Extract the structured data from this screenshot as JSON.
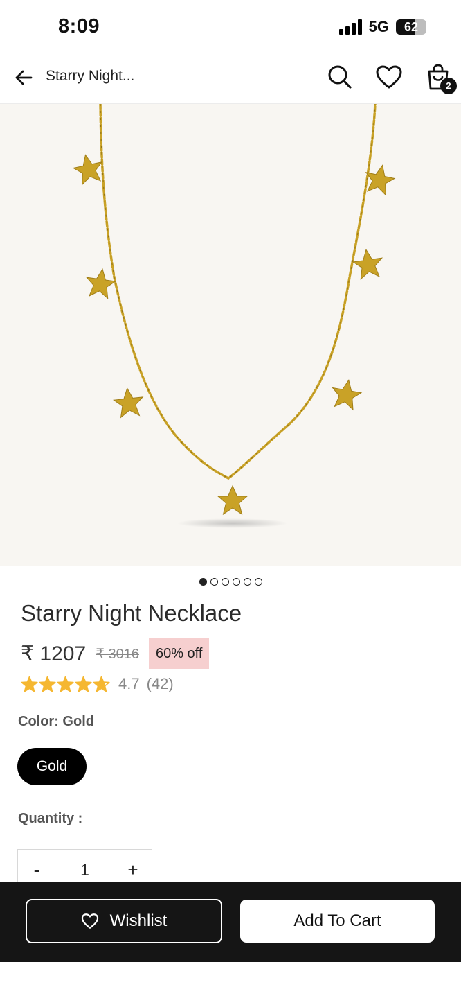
{
  "status_bar": {
    "time": "8:09",
    "network": "5G",
    "battery": "62",
    "battery_level": 0.62
  },
  "header": {
    "title": "Starry Night...",
    "cart_count": "2"
  },
  "gallery": {
    "total": 6,
    "active": 1
  },
  "product": {
    "title": "Starry Night Necklace",
    "price": "₹ 1207",
    "mrp": "₹ 3016",
    "discount": "60% off",
    "rating_value": "4.7",
    "rating_count": "(42)",
    "rating": 4.7,
    "color_label": "Color: Gold",
    "color_option": "Gold",
    "quantity_label": "Quantity :",
    "quantity": "1",
    "minus": "-",
    "plus": "+"
  },
  "actions": {
    "wishlist": "Wishlist",
    "add_to_cart": "Add To Cart"
  },
  "colors": {
    "accent": "#000000",
    "discount_bg": "#f6cfcf",
    "star": "#f5b731",
    "gold": "#c9a227"
  }
}
